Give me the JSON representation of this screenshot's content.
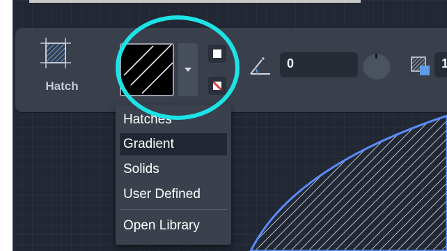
{
  "ribbon": {
    "hatch_tool": {
      "label": "Hatch",
      "icon": "hatch-icon"
    },
    "pattern_preview": {
      "icon": "hatch-pattern-swatch-icon"
    },
    "pattern_dropdown": {
      "icon": "chevron-down-icon"
    },
    "fill_color_button": {
      "icon": "white-square-icon"
    },
    "background_color_button": {
      "icon": "no-color-icon"
    },
    "angle": {
      "icon": "angle-icon",
      "value": "0"
    },
    "angle_dial": {
      "icon": "dial-icon"
    },
    "scale": {
      "icon": "hatch-scale-icon",
      "value": "1"
    }
  },
  "pattern_menu": {
    "items": [
      {
        "label": "Hatches",
        "selected": false
      },
      {
        "label": "Gradient",
        "selected": true
      },
      {
        "label": "Solids",
        "selected": false
      },
      {
        "label": "User Defined",
        "selected": false
      }
    ],
    "footer_item": {
      "label": "Open Library"
    }
  },
  "colors": {
    "canvas": "#212733",
    "ribbon": "#39404c",
    "menu": "#3a414d",
    "menu_selected": "#222833",
    "highlight_circle": "#1ee3e6",
    "shape_outline": "#4a7cf0"
  }
}
